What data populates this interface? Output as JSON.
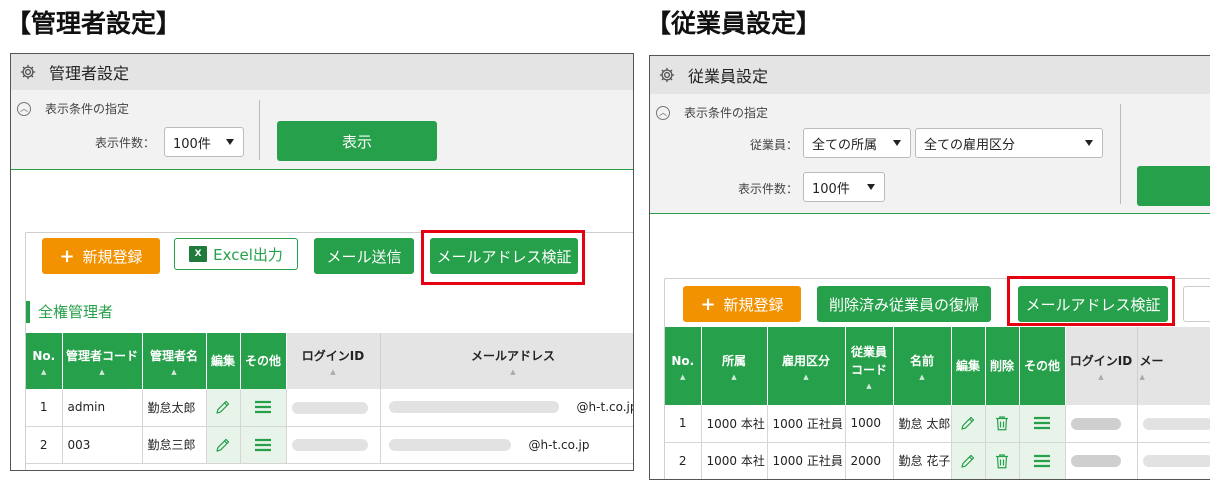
{
  "captions": {
    "left": "【管理者設定】",
    "right": "【従業員設定】"
  },
  "admin": {
    "title": "管理者設定",
    "filter_toggle": "表示条件の指定",
    "count_label": "表示件数：",
    "count_value": "100件",
    "show_button": "表示",
    "buttons": {
      "new": "新規登録",
      "excel": "Excel出力",
      "mail_send": "メール送信",
      "mail_verify": "メールアドレス検証"
    },
    "section_title": "全権管理者",
    "columns": [
      "No.",
      "管理者コード",
      "管理者名",
      "編集",
      "その他",
      "ログインID",
      "メールアドレス"
    ],
    "rows": [
      {
        "no": "1",
        "code": "admin",
        "name": "勤怠太郎",
        "domain": "@h-t.co.jp"
      },
      {
        "no": "2",
        "code": "003",
        "name": "勤怠三郎",
        "domain": "@h-t.co.jp"
      }
    ]
  },
  "employee": {
    "title": "従業員設定",
    "filter_toggle": "表示条件の指定",
    "employee_label": "従業員：",
    "affiliation_value": "全ての所属",
    "employment_value": "全ての雇用区分",
    "count_label": "表示件数：",
    "count_value": "100件",
    "buttons": {
      "new": "新規登録",
      "restore": "削除済み従業員の復帰",
      "mail_verify": "メールアドレス検証"
    },
    "columns": [
      "No.",
      "所属",
      "雇用区分",
      "従業員コード",
      "名前",
      "編集",
      "削除",
      "その他",
      "ログインID",
      "メー"
    ],
    "col_employee_code_l1": "従業員",
    "col_employee_code_l2": "コード",
    "rows": [
      {
        "no": "1",
        "dept": "1000 本社",
        "type": "1000 正社員",
        "code": "1000",
        "name": "勤怠 太郎"
      },
      {
        "no": "2",
        "dept": "1000 本社",
        "type": "1000 正社員",
        "code": "2000",
        "name": "勤怠 花子"
      }
    ]
  },
  "colors": {
    "green": "#26a04a",
    "orange": "#f39200",
    "red_highlight": "#e50012"
  },
  "icons": [
    "gear-icon",
    "chevron-up-icon",
    "plus-icon",
    "excel-icon",
    "pencil-icon",
    "menu-icon",
    "trash-icon",
    "caret-down-icon"
  ]
}
